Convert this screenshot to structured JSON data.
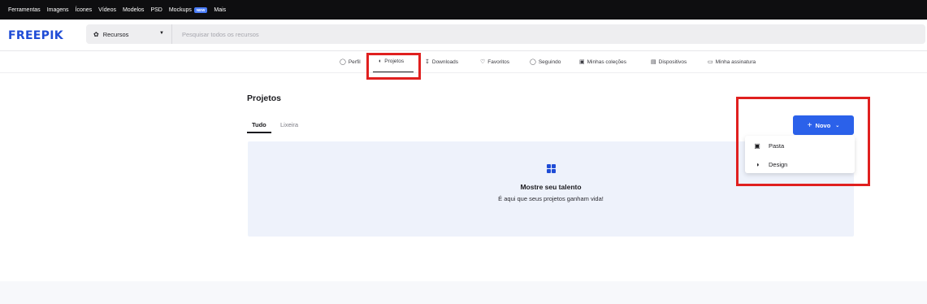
{
  "topnav": {
    "items": [
      "Ferramentas",
      "Imagens",
      "Ícones",
      "Vídeos",
      "Modelos",
      "PSD",
      "Mockups",
      "Mais"
    ],
    "mockups_badge": "NEW"
  },
  "header": {
    "logo": "FREEPIK",
    "resource_select": "Recursos",
    "search_placeholder": "Pesquisar todos os recursos"
  },
  "profile_tabs": [
    {
      "label": "Perfil",
      "icon": "user-icon"
    },
    {
      "label": "Projetos",
      "icon": "projects-icon"
    },
    {
      "label": "Downloads",
      "icon": "download-icon"
    },
    {
      "label": "Favoritos",
      "icon": "heart-icon"
    },
    {
      "label": "Seguindo",
      "icon": "user-follow-icon"
    },
    {
      "label": "Minhas coleções",
      "icon": "folder-icon"
    },
    {
      "label": "Dispositivos",
      "icon": "laptop-icon"
    },
    {
      "label": "Minha assinatura",
      "icon": "card-icon"
    }
  ],
  "main": {
    "title": "Projetos",
    "tabs": [
      "Tudo",
      "Lixeira"
    ],
    "new_button": "Novo",
    "empty_title": "Mostre seu talento",
    "empty_subtitle": "É aqui que seus projetos ganham vida!"
  },
  "dropdown": {
    "items": [
      {
        "label": "Pasta",
        "icon": "folder-plus-icon"
      },
      {
        "label": "Design",
        "icon": "palette-icon"
      }
    ]
  },
  "colors": {
    "brand": "#1f4cd6",
    "button": "#2b61ea",
    "highlight": "#e0201f",
    "panel": "#eef2fb"
  }
}
